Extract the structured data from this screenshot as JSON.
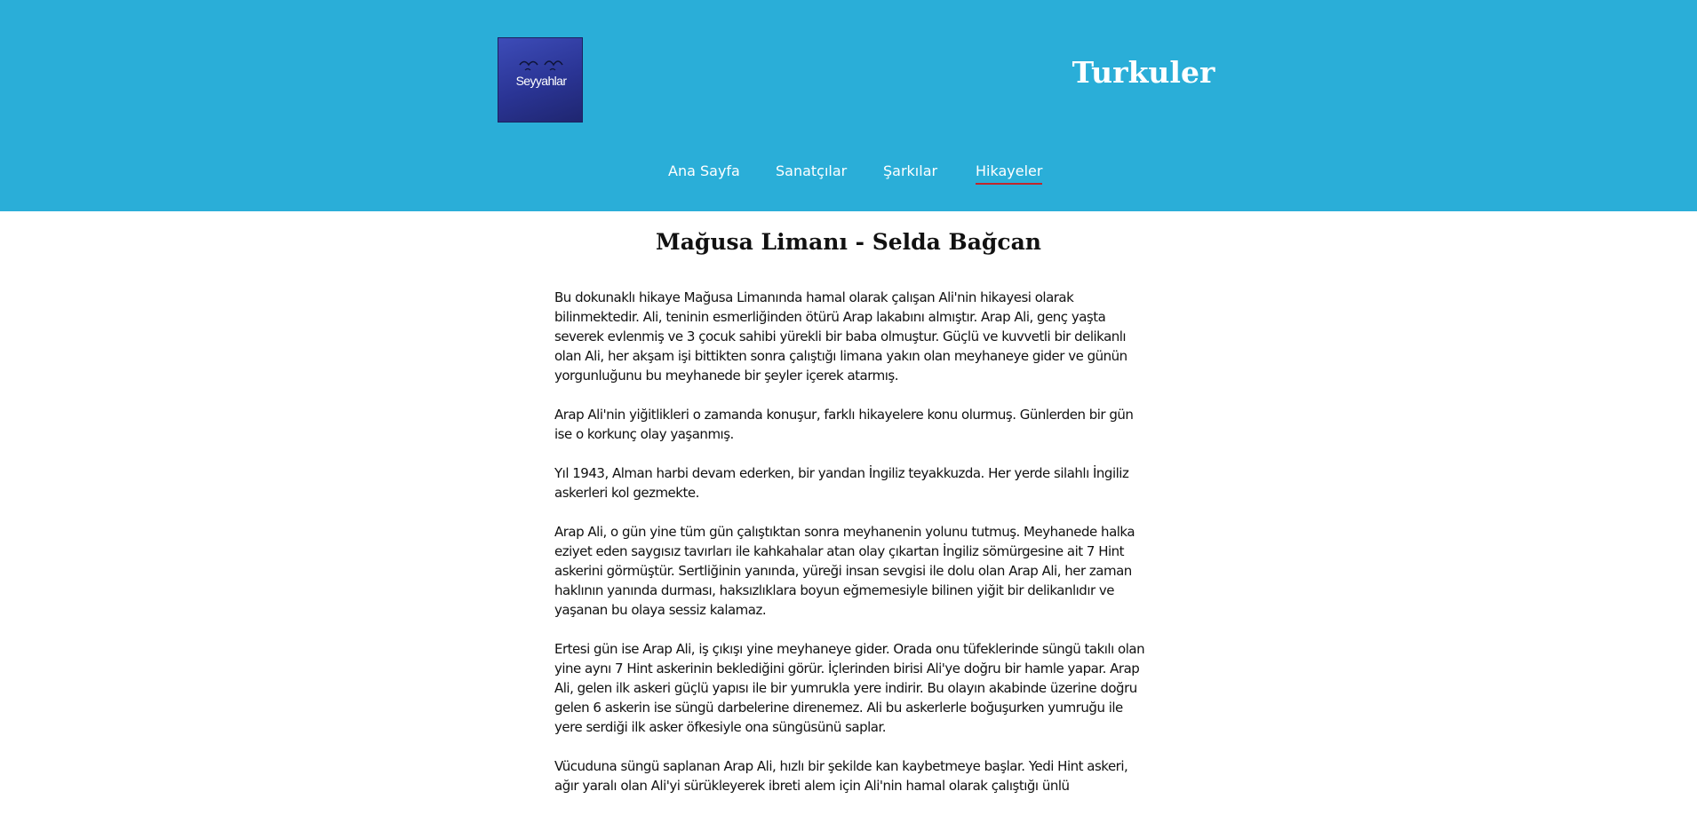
{
  "header": {
    "logo_text": "Seyyahlar",
    "site_title": "Turkuler"
  },
  "nav": {
    "items": [
      {
        "label": "Ana Sayfa",
        "active": false
      },
      {
        "label": "Sanatçılar",
        "active": false
      },
      {
        "label": "Şarkılar",
        "active": false
      },
      {
        "label": "Hikayeler",
        "active": true
      }
    ]
  },
  "colors": {
    "header_bg": "#2aaed8",
    "active_underline": "#c0262b",
    "logo_bg": "#2a3494"
  },
  "article": {
    "title": "Mağusa Limanı - Selda Bağcan",
    "paragraphs": [
      "Bu dokunaklı hikaye Mağusa Limanında hamal olarak çalışan Ali'nin hikayesi olarak bilinmektedir. Ali, teninin esmerliğinden ötürü Arap lakabını almıştır. Arap Ali, genç yaşta severek evlenmiş ve 3 çocuk sahibi yürekli bir baba olmuştur. Güçlü ve kuvvetli bir delikanlı olan Ali, her akşam işi bittikten sonra çalıştığı limana yakın olan meyhaneye gider ve günün yorgunluğunu bu meyhanede bir şeyler içerek atarmış.",
      "Arap Ali'nin yiğitlikleri o zamanda konuşur, farklı hikayelere konu olurmuş. Günlerden bir gün ise o korkunç olay yaşanmış.",
      "Yıl 1943, Alman harbi devam ederken, bir yandan İngiliz teyakkuzda. Her yerde silahlı İngiliz askerleri kol gezmekte.",
      "Arap Ali, o gün yine tüm gün çalıştıktan sonra meyhanenin yolunu tutmuş. Meyhanede halka eziyet eden saygısız tavırları ile kahkahalar atan olay çıkartan İngiliz sömürgesine ait 7 Hint askerini görmüştür. Sertliğinin yanında, yüreği insan sevgisi ile dolu olan Arap Ali, her zaman haklının yanında durması, haksızlıklara boyun eğmemesiyle bilinen yiğit bir delikanlıdır ve yaşanan bu olaya sessiz kalamaz.",
      "Ertesi gün ise Arap Ali, iş çıkışı yine meyhaneye gider. Orada onu tüfeklerinde süngü takılı olan yine aynı 7 Hint askerinin beklediğini görür. İçlerinden birisi Ali'ye doğru bir hamle yapar. Arap Ali, gelen ilk askeri güçlü yapısı ile bir yumrukla yere indirir. Bu olayın akabinde üzerine doğru gelen 6 askerin ise süngü darbelerine direnemez. Ali bu askerlerle boğuşurken yumruğu ile yere serdiği ilk asker öfkesiyle ona süngüsünü saplar.",
      "Vücuduna süngü saplanan Arap Ali, hızlı bir şekilde kan kaybetmeye başlar. Yedi Hint askeri, ağır yaralı olan Ali'yi sürükleyerek ibreti alem için Ali'nin hamal olarak çalıştığı ünlü"
    ]
  }
}
